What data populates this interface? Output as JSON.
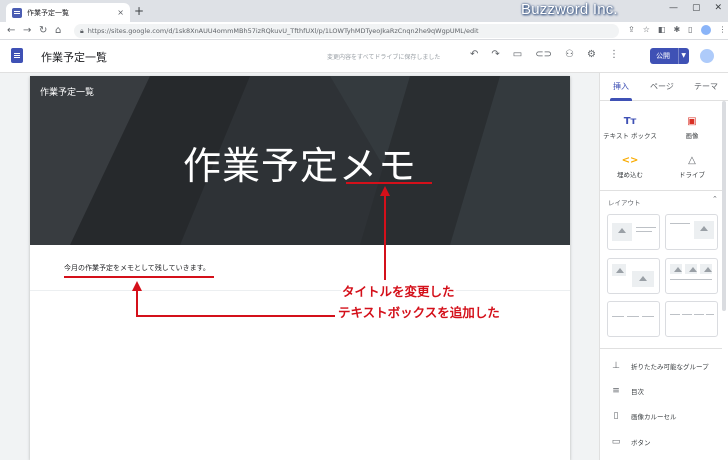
{
  "browser": {
    "tab_title": "作業予定一覧",
    "tab_close": "×",
    "new_tab": "+",
    "url": "https://sites.google.com/d/1sk8XnAUU4ommMBh57izRQkuvU_TfthfUXl/p/1LOWTyhMDTyeoJkaRzCnqn2he9qWgpUML/edit",
    "watermark": "Buzzword Inc."
  },
  "sites": {
    "doc_title": "作業予定一覧",
    "save_status": "変更内容をすべてドライブに保存しました",
    "publish_label": "公開"
  },
  "page": {
    "site_name": "作業予定一覧",
    "hero_title": "作業予定メモ",
    "textbox_text": "今月の作業予定をメモとして残していきます。"
  },
  "annotations": {
    "title_changed": "タイトルを変更した",
    "textbox_added": "テキストボックスを追加した"
  },
  "right_panel": {
    "tabs": [
      "挿入",
      "ページ",
      "テーマ"
    ],
    "active_tab": "挿入",
    "insert_items": [
      {
        "label": "テキスト ボックス",
        "icon": "text-box-icon",
        "glyph": "Tт",
        "color": "#3f51b5"
      },
      {
        "label": "画像",
        "icon": "image-icon",
        "glyph": "▣",
        "color": "#d93025"
      },
      {
        "label": "埋め込む",
        "icon": "embed-icon",
        "glyph": "<>",
        "color": "#f9ab00"
      },
      {
        "label": "ドライブ",
        "icon": "drive-icon",
        "glyph": "△",
        "color": "#5f6368"
      }
    ],
    "layout_header": "レイアウト",
    "components": [
      {
        "label": "折りたたみ可能なグループ",
        "icon": "collapsible-group-icon",
        "glyph": "⊥"
      },
      {
        "label": "目次",
        "icon": "table-of-contents-icon",
        "glyph": "≡"
      },
      {
        "label": "画像カルーセル",
        "icon": "image-carousel-icon",
        "glyph": "▯"
      },
      {
        "label": "ボタン",
        "icon": "button-icon",
        "glyph": "▭"
      }
    ]
  },
  "colors": {
    "accent": "#3f51b5",
    "annotation_red": "#d4101a",
    "banner_dark": "#2f3336"
  }
}
